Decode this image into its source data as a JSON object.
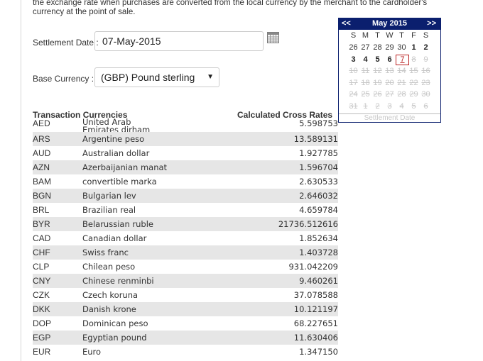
{
  "intro_text": "the exchange rate when purchases are converted from the local currency by the merchant to the cardholder's currency at the point of sale.",
  "settlement": {
    "label": "Settlement Date :",
    "value": "07-May-2015"
  },
  "base_currency": {
    "label": "Base Currency :",
    "value": "(GBP) Pound sterling"
  },
  "table": {
    "header_currencies": "Transaction Currencies",
    "header_rates": "Calculated Cross Rates",
    "rows": [
      {
        "code": "AED",
        "name": "United Arab Emirates dirham",
        "rate": "5.598753"
      },
      {
        "code": "ARS",
        "name": "Argentine peso",
        "rate": "13.589131"
      },
      {
        "code": "AUD",
        "name": "Australian dollar",
        "rate": "1.927785"
      },
      {
        "code": "AZN",
        "name": "Azerbaijanian manat",
        "rate": "1.596704"
      },
      {
        "code": "BAM",
        "name": "convertible marka",
        "rate": "2.630533"
      },
      {
        "code": "BGN",
        "name": "Bulgarian lev",
        "rate": "2.646032"
      },
      {
        "code": "BRL",
        "name": "Brazilian real",
        "rate": "4.659784"
      },
      {
        "code": "BYR",
        "name": "Belarussian ruble",
        "rate": "21736.512616"
      },
      {
        "code": "CAD",
        "name": "Canadian dollar",
        "rate": "1.852634"
      },
      {
        "code": "CHF",
        "name": "Swiss franc",
        "rate": "1.403728"
      },
      {
        "code": "CLP",
        "name": "Chilean peso",
        "rate": "931.042209"
      },
      {
        "code": "CNY",
        "name": "Chinese renminbi",
        "rate": "9.460261"
      },
      {
        "code": "CZK",
        "name": "Czech koruna",
        "rate": "37.078588"
      },
      {
        "code": "DKK",
        "name": "Danish krone",
        "rate": "10.121197"
      },
      {
        "code": "DOP",
        "name": "Dominican peso",
        "rate": "68.227651"
      },
      {
        "code": "EGP",
        "name": "Egyptian pound",
        "rate": "11.630406"
      },
      {
        "code": "EUR",
        "name": "Euro",
        "rate": "1.347150"
      }
    ]
  },
  "calendar": {
    "prev": "<<",
    "next": ">>",
    "title": "May 2015",
    "weekdays": [
      "S",
      "M",
      "T",
      "W",
      "T",
      "F",
      "S"
    ],
    "weeks": [
      [
        {
          "d": "26",
          "s": "prevm"
        },
        {
          "d": "27",
          "s": "prevm"
        },
        {
          "d": "28",
          "s": "prevm"
        },
        {
          "d": "29",
          "s": "prevm"
        },
        {
          "d": "30",
          "s": "prevm"
        },
        {
          "d": "1",
          "s": "on"
        },
        {
          "d": "2",
          "s": "on"
        }
      ],
      [
        {
          "d": "3",
          "s": "on"
        },
        {
          "d": "4",
          "s": "on"
        },
        {
          "d": "5",
          "s": "on"
        },
        {
          "d": "6",
          "s": "on"
        },
        {
          "d": "7",
          "s": "sel"
        },
        {
          "d": "8",
          "s": "dis"
        },
        {
          "d": "9",
          "s": "dis"
        }
      ],
      [
        {
          "d": "10",
          "s": "dis"
        },
        {
          "d": "11",
          "s": "dis"
        },
        {
          "d": "12",
          "s": "dis"
        },
        {
          "d": "13",
          "s": "dis"
        },
        {
          "d": "14",
          "s": "dis"
        },
        {
          "d": "15",
          "s": "dis"
        },
        {
          "d": "16",
          "s": "dis"
        }
      ],
      [
        {
          "d": "17",
          "s": "dis"
        },
        {
          "d": "18",
          "s": "dis"
        },
        {
          "d": "19",
          "s": "dis"
        },
        {
          "d": "20",
          "s": "dis"
        },
        {
          "d": "21",
          "s": "dis"
        },
        {
          "d": "22",
          "s": "dis"
        },
        {
          "d": "23",
          "s": "dis"
        }
      ],
      [
        {
          "d": "24",
          "s": "dis"
        },
        {
          "d": "25",
          "s": "dis"
        },
        {
          "d": "26",
          "s": "dis"
        },
        {
          "d": "27",
          "s": "dis"
        },
        {
          "d": "28",
          "s": "dis"
        },
        {
          "d": "29",
          "s": "dis"
        },
        {
          "d": "30",
          "s": "dis"
        }
      ],
      [
        {
          "d": "31",
          "s": "dis"
        },
        {
          "d": "1",
          "s": "dis"
        },
        {
          "d": "2",
          "s": "dis"
        },
        {
          "d": "3",
          "s": "dis"
        },
        {
          "d": "4",
          "s": "dis"
        },
        {
          "d": "5",
          "s": "dis"
        },
        {
          "d": "6",
          "s": "dis"
        }
      ]
    ],
    "footer": "Settlement Date"
  },
  "colors": {
    "calendar_header": "#0b1f6e",
    "selected_day": "#bb2222",
    "stripe": "#e6e6e6"
  },
  "icons": {
    "calendar_button": "calendar-icon",
    "select_arrow": "chevron-down-icon"
  }
}
